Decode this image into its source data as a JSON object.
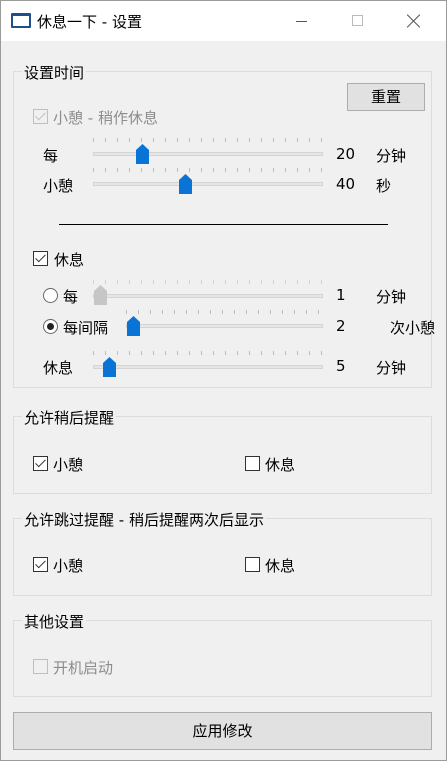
{
  "window": {
    "title": "休息一下 - 设置"
  },
  "group_time": {
    "title": "设置时间",
    "reset_label": "重置",
    "short_break_label": "小憩 - 稍作休息",
    "every_label": "每",
    "every_value": "20",
    "every_unit": "分钟",
    "short_label": "小憩",
    "short_value": "40",
    "short_unit": "秒",
    "long_break_label": "休息",
    "radio_every_label": "每",
    "radio_every_value": "1",
    "radio_every_unit": "分钟",
    "radio_interval_label": "每间隔",
    "radio_interval_value": "2",
    "radio_interval_unit": "次小憩",
    "rest_label": "休息",
    "rest_value": "5",
    "rest_unit": "分钟"
  },
  "group_postpone": {
    "title": "允许稍后提醒",
    "short_label": "小憩",
    "long_label": "休息"
  },
  "group_skip": {
    "title": "允许跳过提醒 - 稍后提醒两次后显示",
    "short_label": "小憩",
    "long_label": "休息"
  },
  "group_other": {
    "title": "其他设置",
    "autostart_label": "开机启动"
  },
  "apply_label": "应用修改",
  "state": {
    "short_break_enabled": true,
    "long_break_enabled": true,
    "radio_selected": "interval",
    "postpone_short": true,
    "postpone_long": false,
    "skip_short": true,
    "skip_long": false,
    "autostart": false
  },
  "colors": {
    "accent": "#0a74d6",
    "background": "#f0f0f0"
  }
}
